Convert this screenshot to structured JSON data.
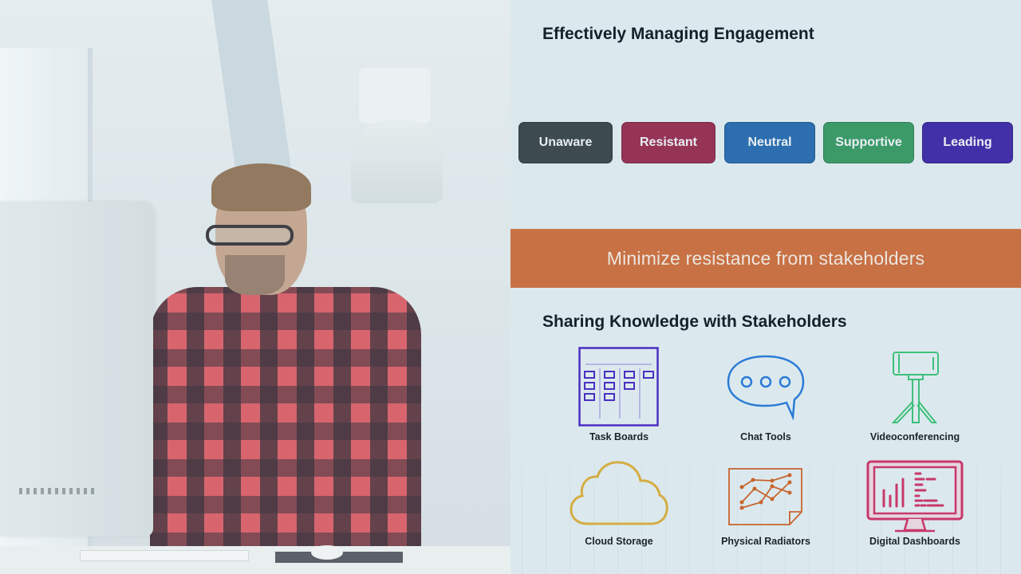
{
  "photo": {
    "description": "Man in red plaid shirt and glasses standing at a desk using a desktop computer in a bright office"
  },
  "engagement": {
    "title": "Effectively Managing Engagement",
    "stages": [
      {
        "label": "Unaware",
        "color": "#3d4a4f"
      },
      {
        "label": "Resistant",
        "color": "#963456"
      },
      {
        "label": "Neutral",
        "color": "#2c6eaf"
      },
      {
        "label": "Supportive",
        "color": "#3c9a69"
      },
      {
        "label": "Leading",
        "color": "#4230a8"
      }
    ]
  },
  "banner": {
    "text": "Minimize resistance from stakeholders",
    "color": "#c87144"
  },
  "knowledge": {
    "title": "Sharing Knowledge with Stakeholders",
    "tools": [
      {
        "label": "Task Boards",
        "icon": "task-board-icon",
        "color": "#4a2fc0"
      },
      {
        "label": "Chat Tools",
        "icon": "chat-bubble-icon",
        "color": "#2b7bd6"
      },
      {
        "label": "Videoconferencing",
        "icon": "phone-tripod-icon",
        "color": "#3fc07a"
      },
      {
        "label": "Cloud Storage",
        "icon": "cloud-icon",
        "color": "#d5ad44"
      },
      {
        "label": "Physical Radiators",
        "icon": "line-chart-paper-icon",
        "color": "#c8642e"
      },
      {
        "label": "Digital Dashboards",
        "icon": "monitor-dashboard-icon",
        "color": "#c8386a"
      }
    ]
  }
}
